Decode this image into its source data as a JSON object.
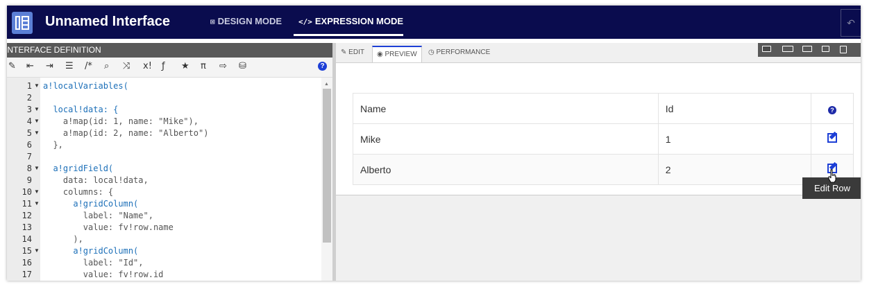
{
  "header": {
    "app_title": "Unnamed Interface",
    "design_mode_label": "DESIGN MODE",
    "expression_mode_label": "EXPRESSION MODE",
    "design_icon": "design-icon",
    "expression_icon": "</>"
  },
  "left_panel": {
    "title": "INTERFACE DEFINITION",
    "toolbar_icons": [
      "magic-wand-icon",
      "outdent-icon",
      "indent-icon",
      "format-icon",
      "comment-icon",
      "search-icon",
      "shuffle-icon",
      "x-icon",
      "function-icon",
      "star-icon",
      "pi-icon",
      "export-icon",
      "database-search-icon",
      "help-icon"
    ],
    "code_lines": [
      {
        "num": "1",
        "fold": true,
        "text": "a!localVariables("
      },
      {
        "num": "2",
        "fold": false,
        "text": ""
      },
      {
        "num": "3",
        "fold": true,
        "text": "  local!data: {"
      },
      {
        "num": "4",
        "fold": true,
        "text": "    a!map(id: 1, name: \"Mike\"),"
      },
      {
        "num": "5",
        "fold": true,
        "text": "    a!map(id: 2, name: \"Alberto\")"
      },
      {
        "num": "6",
        "fold": false,
        "text": "  },"
      },
      {
        "num": "7",
        "fold": false,
        "text": ""
      },
      {
        "num": "8",
        "fold": true,
        "text": "  a!gridField("
      },
      {
        "num": "9",
        "fold": false,
        "text": "    data: local!data,"
      },
      {
        "num": "10",
        "fold": true,
        "text": "    columns: {"
      },
      {
        "num": "11",
        "fold": true,
        "text": "      a!gridColumn("
      },
      {
        "num": "12",
        "fold": false,
        "text": "        label: \"Name\","
      },
      {
        "num": "13",
        "fold": false,
        "text": "        value: fv!row.name"
      },
      {
        "num": "14",
        "fold": false,
        "text": "      ),"
      },
      {
        "num": "15",
        "fold": true,
        "text": "      a!gridColumn("
      },
      {
        "num": "16",
        "fold": false,
        "text": "        label: \"Id\","
      },
      {
        "num": "17",
        "fold": false,
        "text": "        value: fv!row.id"
      }
    ]
  },
  "right_panel": {
    "tabs": [
      {
        "label": "EDIT",
        "icon": "edit-icon"
      },
      {
        "label": "PREVIEW",
        "icon": "eye-icon"
      },
      {
        "label": "PERFORMANCE",
        "icon": "clock-icon"
      }
    ],
    "grid": {
      "headers": [
        "Name",
        "Id"
      ],
      "rows": [
        {
          "name": "Mike",
          "id": "1"
        },
        {
          "name": "Alberto",
          "id": "2"
        }
      ]
    },
    "tooltip": "Edit Row"
  },
  "colors": {
    "header_bg": "#0a0c4e",
    "accent": "#1d3fd6"
  }
}
